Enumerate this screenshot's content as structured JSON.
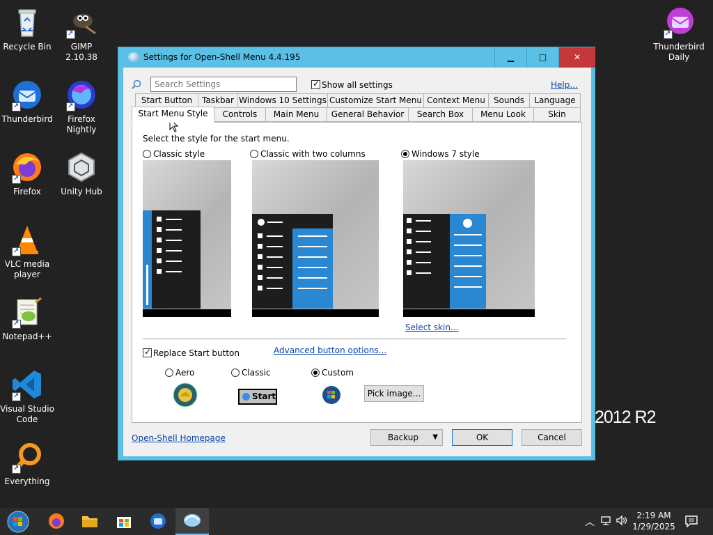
{
  "desktop": {
    "icons_left": [
      {
        "label": "Recycle Bin",
        "icon": "recycle-bin-icon"
      },
      {
        "label": "GIMP 2.10.38",
        "icon": "gimp-icon"
      },
      {
        "label": "Thunderbird",
        "icon": "thunderbird-icon"
      },
      {
        "label": "Firefox Nightly",
        "icon": "firefox-nightly-icon"
      },
      {
        "label": "Firefox",
        "icon": "firefox-icon"
      },
      {
        "label": "Unity Hub",
        "icon": "unity-hub-icon"
      },
      {
        "label": "VLC media player",
        "icon": "vlc-icon"
      },
      {
        "label": "Notepad++",
        "icon": "notepadpp-icon"
      },
      {
        "label": "Visual Studio Code",
        "icon": "vscode-icon"
      },
      {
        "label": "Everything",
        "icon": "everything-icon"
      }
    ],
    "icon_right": {
      "label": "Thunderbird Daily",
      "icon": "thunderbird-daily-icon"
    },
    "server_watermark": "2012 R2"
  },
  "window": {
    "title": "Settings for Open-Shell Menu 4.4.195",
    "search_placeholder": "Search Settings",
    "show_all_label": "Show all settings",
    "show_all_checked": true,
    "help_link": "Help...",
    "tabs_row1": [
      "Start Button",
      "Taskbar",
      "Windows 10 Settings",
      "Customize Start Menu",
      "Context Menu",
      "Sounds",
      "Language"
    ],
    "tabs_row2": [
      "Start Menu Style",
      "Controls",
      "Main Menu",
      "General Behavior",
      "Search Box",
      "Menu Look",
      "Skin"
    ],
    "active_tab": "Start Menu Style",
    "style_desc": "Select the style for the start menu.",
    "style_options": [
      {
        "label": "Classic style",
        "selected": false
      },
      {
        "label": "Classic with two columns",
        "selected": false
      },
      {
        "label": "Windows 7 style",
        "selected": true
      }
    ],
    "select_skin_link": "Select skin...",
    "replace_start_label": "Replace Start button",
    "replace_start_checked": true,
    "advanced_link": "Advanced button options...",
    "button_styles": [
      {
        "label": "Aero",
        "selected": false
      },
      {
        "label": "Classic",
        "selected": false
      },
      {
        "label": "Custom",
        "selected": true
      }
    ],
    "classic_button_text": "Start",
    "pick_image_label": "Pick image...",
    "homepage_link": "Open-Shell Homepage",
    "backup_label": "Backup",
    "ok_label": "OK",
    "cancel_label": "Cancel"
  },
  "taskbar": {
    "items": [
      "start-orb-icon",
      "firefox-icon",
      "file-explorer-icon",
      "store-icon",
      "thunderbird-icon",
      "open-shell-icon"
    ],
    "time": "2:19 AM",
    "date": "1/29/2025"
  },
  "colors": {
    "window_frame": "#5bc0e6",
    "close_button": "#c5383a",
    "menu_blue": "#2a87d2",
    "link": "#0645ad"
  }
}
